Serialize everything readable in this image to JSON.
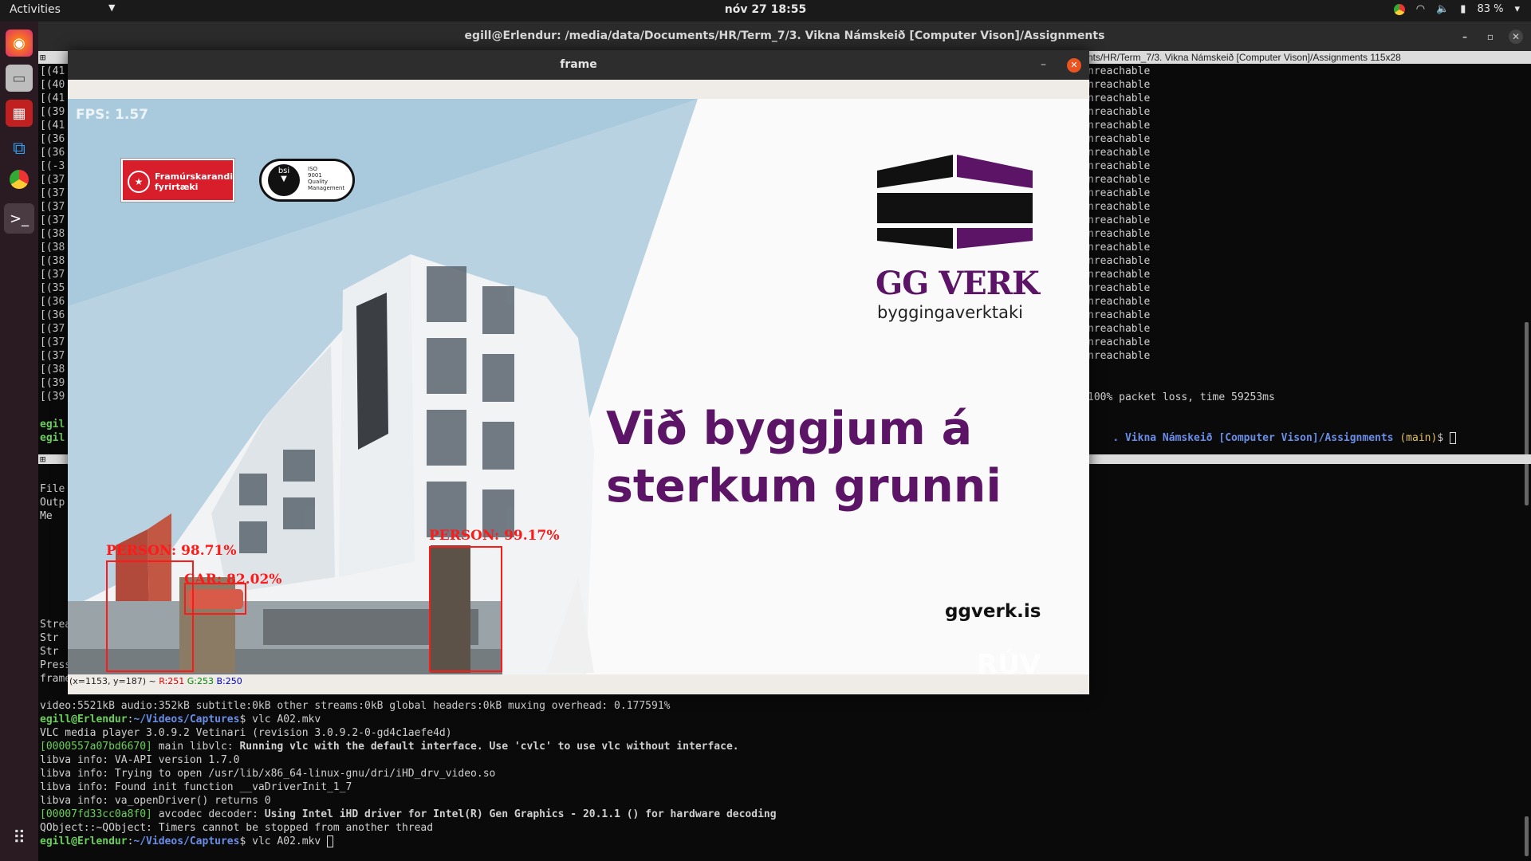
{
  "topbar": {
    "activities": "Activities",
    "clock": "nóv 27  18:55",
    "battery": "83 %"
  },
  "terminal": {
    "title": "egill@Erlendur: /media/data/Documents/HR/Term_7/3. Vikna Námskeið [Computer Vison]/Assignments",
    "pane_title": "nts/HR/Term_7/3. Vikna Námskeið [Computer Vison]/Assignments 115x28",
    "left_fragments": [
      "[(41",
      "[(40",
      "[(41",
      "[(39",
      "[(41",
      "[(36",
      "[(36",
      "[(-3",
      "[(37",
      "[(37",
      "[(37",
      "[(37",
      "[(38",
      "[(38",
      "[(38",
      "[(37",
      "[(35",
      "[(36",
      "[(36",
      "[(37",
      "[(37",
      "[(37",
      "[(38",
      "[(39",
      "[(39"
    ],
    "prompt_fragments": [
      "egil",
      "egil"
    ],
    "lower_left_fragments": [
      "File",
      "Outp",
      "Me",
      "",
      "",
      "",
      "",
      "",
      "",
      "",
      "Strea",
      "Str",
      "Str",
      "Press",
      "frame"
    ],
    "unreachable": "nreachable",
    "packet_loss": "100% packet loss, time 59253ms",
    "right_prompt": {
      "path": ". Vikna Námskeið [Computer Vison]/Assignments",
      "branch": "(main)",
      "sym": "$"
    },
    "bottom_lines": [
      {
        "type": "plain",
        "text": "video:5521kB audio:352kB subtitle:0kB other streams:0kB global headers:0kB muxing overhead: 0.177591%"
      },
      {
        "type": "prompt",
        "user": "egill@Erlendur",
        "path": "~/Videos/Captures",
        "cmd": "$ vlc A02.mkv"
      },
      {
        "type": "plain",
        "text": "VLC media player 3.0.9.2 Vetinari (revision 3.0.9.2-0-gd4c1aefe4d)"
      },
      {
        "type": "tagged",
        "tag": "[0000557a07bd6670]",
        "mid": " main libvlc: ",
        "bold": "Running vlc with the default interface. Use 'cvlc' to use vlc without interface."
      },
      {
        "type": "plain",
        "text": "libva info: VA-API version 1.7.0"
      },
      {
        "type": "plain",
        "text": "libva info: Trying to open /usr/lib/x86_64-linux-gnu/dri/iHD_drv_video.so"
      },
      {
        "type": "plain",
        "text": "libva info: Found init function __vaDriverInit_1_7"
      },
      {
        "type": "plain",
        "text": "libva info: va_openDriver() returns 0"
      },
      {
        "type": "tagged",
        "tag": "[00007fd33cc0a8f0]",
        "mid": " avcodec decoder: ",
        "bold": "Using Intel iHD driver for Intel(R) Gen Graphics - 20.1.1 () for hardware decoding"
      },
      {
        "type": "plain",
        "text": "QObject::~QObject: Timers cannot be stopped from another thread"
      },
      {
        "type": "prompt",
        "user": "egill@Erlendur",
        "path": "~/Videos/Captures",
        "cmd": "$ vlc A02.mkv "
      }
    ]
  },
  "frame_window": {
    "title": "frame",
    "status": {
      "coords": "(x=1153, y=187) ~ ",
      "r": "R:251",
      "g": "G:253",
      "b": "B:250"
    },
    "video": {
      "fps": "FPS: 1.57",
      "badge1": {
        "line1": "Framúrskarandi",
        "line2": "fyrirtæki"
      },
      "badge2": {
        "brand": "bsi",
        "line1": "ISO",
        "line2": "9001",
        "line3": "Quality",
        "line4": "Management"
      },
      "brand_name": "GG VERK",
      "brand_sub": "byggingaverktaki",
      "slogan1": "Við byggjum á",
      "slogan2": "sterkum grunni",
      "url": "ggverk.is",
      "watermark": "RÚV",
      "detections": [
        {
          "label": "PERSON: 98.71%"
        },
        {
          "label": "CAR: 82.02%"
        },
        {
          "label": "PERSON: 99.17%"
        }
      ]
    }
  },
  "colors": {
    "brand_purple": "#5b1466",
    "bbox_red": "#ff1a1a",
    "prompt_green": "#6ad05a",
    "prompt_blue": "#6a8ee8",
    "close_orange": "#e95420"
  }
}
